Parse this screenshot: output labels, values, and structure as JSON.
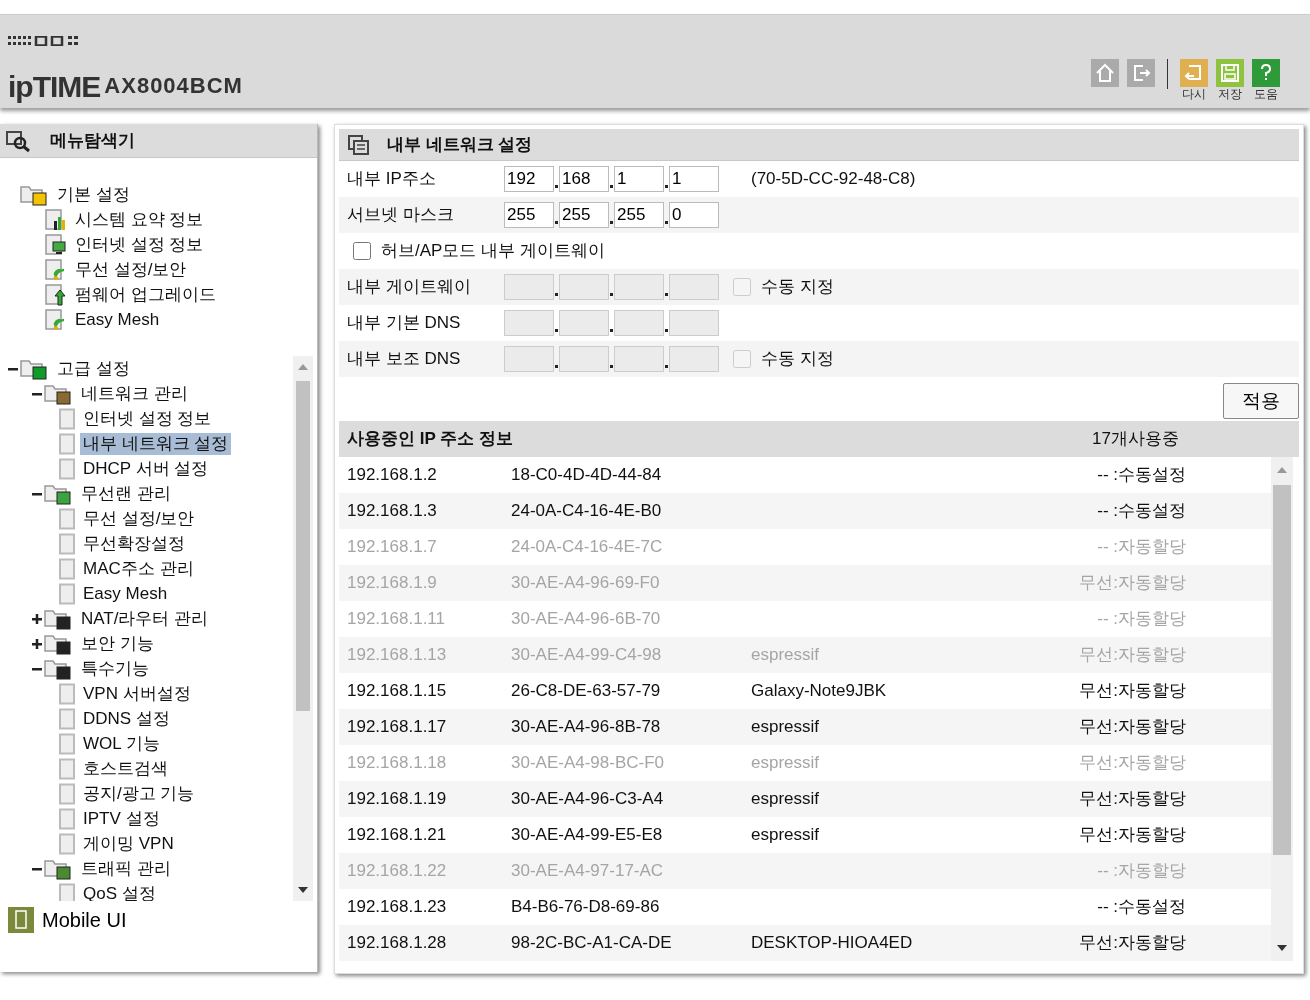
{
  "header": {
    "logo": "ipTIME",
    "model": "AX8004BCM",
    "tools": [
      {
        "kind": "home"
      },
      {
        "kind": "logout"
      },
      {
        "kind": "reload",
        "label": "다시"
      },
      {
        "kind": "save",
        "label": "저장"
      },
      {
        "kind": "help",
        "label": "도움"
      }
    ]
  },
  "sidebar": {
    "title": "메뉴탐색기",
    "tree": [
      {
        "label": "기본 설정",
        "kind": "folder",
        "selected": false,
        "children": [
          {
            "label": "시스템 요약 정보",
            "kind": "page",
            "selected": false
          },
          {
            "label": "인터넷 설정 정보",
            "kind": "page",
            "selected": false
          },
          {
            "label": "무선 설정/보안",
            "kind": "page",
            "selected": false
          },
          {
            "label": "펌웨어 업그레이드",
            "kind": "page",
            "selected": false
          },
          {
            "label": "Easy Mesh",
            "kind": "page",
            "selected": false
          }
        ]
      },
      {
        "label": "고급 설정",
        "kind": "folder",
        "expanded": true,
        "selected": false,
        "children": [
          {
            "label": "네트워크 관리",
            "kind": "folder",
            "expanded": true,
            "selected": false,
            "children": [
              {
                "label": "인터넷 설정 정보",
                "kind": "leaf",
                "selected": false
              },
              {
                "label": "내부 네트워크 설정",
                "kind": "leaf",
                "selected": true
              },
              {
                "label": "DHCP 서버 설정",
                "kind": "leaf",
                "selected": false
              }
            ]
          },
          {
            "label": "무선랜 관리",
            "kind": "folder",
            "expanded": true,
            "selected": false,
            "children": [
              {
                "label": "무선 설정/보안",
                "kind": "leaf",
                "selected": false
              },
              {
                "label": "무선확장설정",
                "kind": "leaf",
                "selected": false
              },
              {
                "label": "MAC주소 관리",
                "kind": "leaf",
                "selected": false
              },
              {
                "label": "Easy Mesh",
                "kind": "leaf",
                "selected": false
              }
            ]
          },
          {
            "label": "NAT/라우터 관리",
            "kind": "folder",
            "expanded": false,
            "selected": false
          },
          {
            "label": "보안 기능",
            "kind": "folder",
            "expanded": false,
            "selected": false
          },
          {
            "label": "특수기능",
            "kind": "folder",
            "expanded": true,
            "selected": false,
            "children": [
              {
                "label": "VPN 서버설정",
                "kind": "leaf",
                "selected": false
              },
              {
                "label": "DDNS 설정",
                "kind": "leaf",
                "selected": false
              },
              {
                "label": "WOL 기능",
                "kind": "leaf",
                "selected": false
              },
              {
                "label": "호스트검색",
                "kind": "leaf",
                "selected": false
              },
              {
                "label": "공지/광고 기능",
                "kind": "leaf",
                "selected": false
              },
              {
                "label": "IPTV 설정",
                "kind": "leaf",
                "selected": false
              },
              {
                "label": "게이밍 VPN",
                "kind": "leaf",
                "selected": false
              }
            ]
          },
          {
            "label": "트래픽 관리",
            "kind": "folder",
            "expanded": true,
            "selected": false,
            "children": [
              {
                "label": "QoS 설정",
                "kind": "leaf",
                "selected": false
              }
            ]
          }
        ]
      }
    ],
    "mobile_link": "Mobile UI"
  },
  "panel": {
    "title": "내부 네트워크 설정",
    "rows": [
      {
        "kind": "ip",
        "label": "내부 IP주소",
        "disabled": false,
        "octets": [
          "192",
          "168",
          "1",
          "1"
        ],
        "note": "(70-5D-CC-92-48-C8)"
      },
      {
        "kind": "ip",
        "label": "서브넷 마스크",
        "disabled": false,
        "octets": [
          "255",
          "255",
          "255",
          "0"
        ]
      },
      {
        "kind": "checkbox",
        "label": "허브/AP모드 내부 게이트웨이",
        "checked": false
      },
      {
        "kind": "ip",
        "label": "내부 게이트웨이",
        "disabled": true,
        "manual": {
          "label": "수동 지정",
          "checked": false,
          "disabled": true
        }
      },
      {
        "kind": "ip",
        "label": "내부 기본 DNS",
        "disabled": true
      },
      {
        "kind": "ip",
        "label": "내부 보조 DNS",
        "disabled": true,
        "manual": {
          "label": "수동 지정",
          "checked": false,
          "disabled": true
        }
      }
    ],
    "apply_button": "적용"
  },
  "leases": {
    "title": "사용중인 IP 주소 정보",
    "count": "17개사용중",
    "rows": [
      {
        "ip": "192.168.1.2",
        "mac": "18-C0-4D-4D-44-84",
        "type": "-- :수동설정",
        "active": true
      },
      {
        "ip": "192.168.1.3",
        "mac": "24-0A-C4-16-4E-B0",
        "type": "-- :수동설정",
        "active": true
      },
      {
        "ip": "192.168.1.7",
        "mac": "24-0A-C4-16-4E-7C",
        "type": "-- :자동할당",
        "active": false
      },
      {
        "ip": "192.168.1.9",
        "mac": "30-AE-A4-96-69-F0",
        "type": "무선:자동할당",
        "active": false
      },
      {
        "ip": "192.168.1.11",
        "mac": "30-AE-A4-96-6B-70",
        "type": "-- :자동할당",
        "active": false
      },
      {
        "ip": "192.168.1.13",
        "mac": "30-AE-A4-99-C4-98",
        "name": "espressif",
        "type": "무선:자동할당",
        "active": false
      },
      {
        "ip": "192.168.1.15",
        "mac": "26-C8-DE-63-57-79",
        "name": "Galaxy-Note9JBK",
        "type": "무선:자동할당",
        "active": true
      },
      {
        "ip": "192.168.1.17",
        "mac": "30-AE-A4-96-8B-78",
        "name": "espressif",
        "type": "무선:자동할당",
        "active": true
      },
      {
        "ip": "192.168.1.18",
        "mac": "30-AE-A4-98-BC-F0",
        "name": "espressif",
        "type": "무선:자동할당",
        "active": false
      },
      {
        "ip": "192.168.1.19",
        "mac": "30-AE-A4-96-C3-A4",
        "name": "espressif",
        "type": "무선:자동할당",
        "active": true
      },
      {
        "ip": "192.168.1.21",
        "mac": "30-AE-A4-99-E5-E8",
        "name": "espressif",
        "type": "무선:자동할당",
        "active": true
      },
      {
        "ip": "192.168.1.22",
        "mac": "30-AE-A4-97-17-AC",
        "type": "-- :자동할당",
        "active": false
      },
      {
        "ip": "192.168.1.23",
        "mac": "B4-B6-76-D8-69-86",
        "type": "-- :수동설정",
        "active": true
      },
      {
        "ip": "192.168.1.28",
        "mac": "98-2C-BC-A1-CA-DE",
        "name": "DESKTOP-HIOA4ED",
        "type": "무선:자동할당",
        "active": true
      }
    ]
  }
}
